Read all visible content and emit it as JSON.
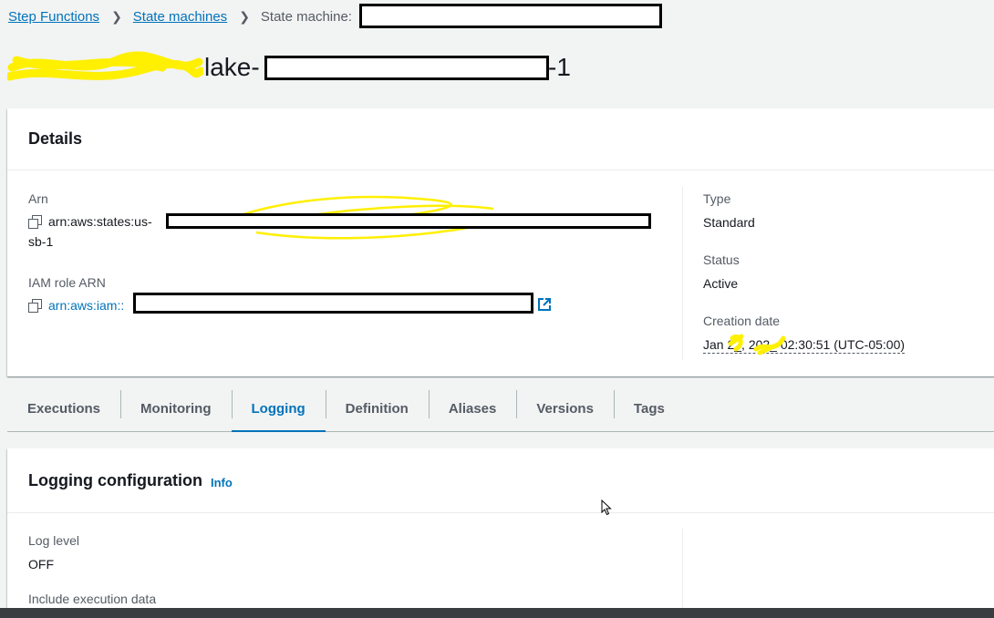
{
  "breadcrumb": {
    "items": [
      "Step Functions",
      "State machines"
    ],
    "current": "State machine:"
  },
  "title": {
    "fragment_a": "lake-",
    "fragment_b": "-1"
  },
  "details": {
    "heading": "Details",
    "arn_label": "Arn",
    "arn_value": "arn:aws:states:us-",
    "arn_continuation": "sb-1",
    "iam_label": "IAM role ARN",
    "iam_value": "arn:aws:iam::",
    "type_label": "Type",
    "type_value": "Standard",
    "status_label": "Status",
    "status_value": "Active",
    "creation_label": "Creation date",
    "creation_value": "Jan 2_, 202_ 02:30:51 (UTC-05:00)"
  },
  "tabs": [
    {
      "label": "Executions",
      "active": false
    },
    {
      "label": "Monitoring",
      "active": false
    },
    {
      "label": "Logging",
      "active": true
    },
    {
      "label": "Definition",
      "active": false
    },
    {
      "label": "Aliases",
      "active": false
    },
    {
      "label": "Versions",
      "active": false
    },
    {
      "label": "Tags",
      "active": false
    }
  ],
  "logging": {
    "heading": "Logging configuration",
    "info": "Info",
    "log_level_label": "Log level",
    "log_level_value": "OFF",
    "include_label": "Include execution data"
  },
  "colors": {
    "link": "#0073bb",
    "redaction_highlight": "#ffff00",
    "redaction_box": "#000000"
  }
}
